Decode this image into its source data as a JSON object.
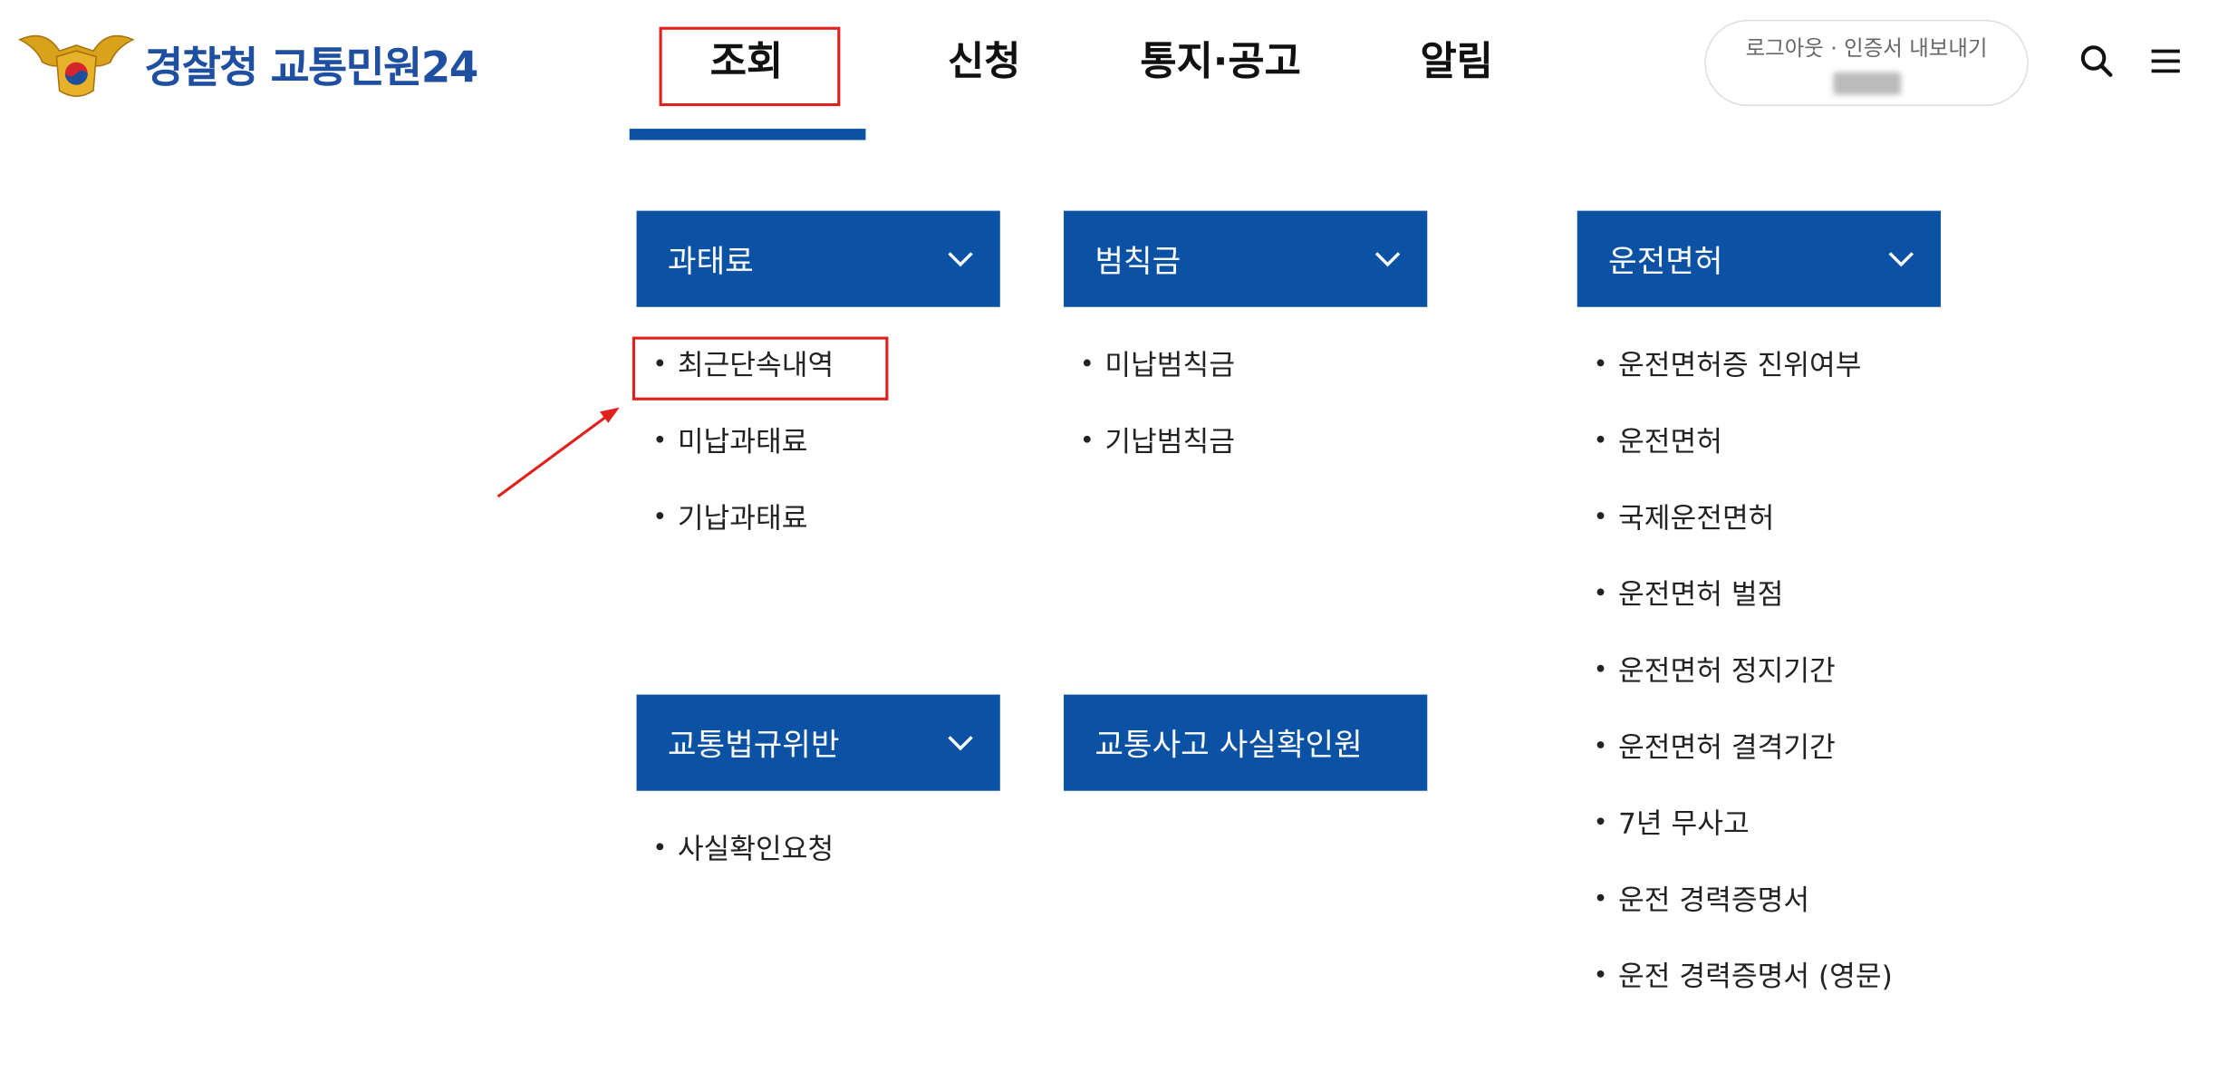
{
  "header": {
    "logo_text": "경찰청 교통민원24",
    "nav": [
      {
        "label": "조회"
      },
      {
        "label": "신청"
      },
      {
        "label": "통지·공고"
      },
      {
        "label": "알림"
      }
    ],
    "user": {
      "logout": "로그아웃",
      "export_cert": "· 인증서 내보내기"
    },
    "icons": [
      "search-icon",
      "menu-icon"
    ]
  },
  "menu": {
    "groups": [
      {
        "title": "과태료",
        "items": [
          "최근단속내역",
          "미납과태료",
          "기납과태료"
        ]
      },
      {
        "title": "범칙금",
        "items": [
          "미납범칙금",
          "기납범칙금"
        ]
      },
      {
        "title": "운전면허",
        "items": [
          "운전면허증 진위여부",
          "운전면허",
          "국제운전면허",
          "운전면허 벌점",
          "운전면허 정지기간",
          "운전면허 결격기간",
          "7년 무사고",
          "운전 경력증명서",
          "운전 경력증명서 (영문)"
        ]
      },
      {
        "title": "교통법규위반",
        "items": [
          "사실확인요청"
        ]
      },
      {
        "title": "교통사고 사실확인원",
        "items": []
      }
    ]
  },
  "colors": {
    "brand_blue": "#0b52a5",
    "highlight_red": "#e0201b"
  }
}
